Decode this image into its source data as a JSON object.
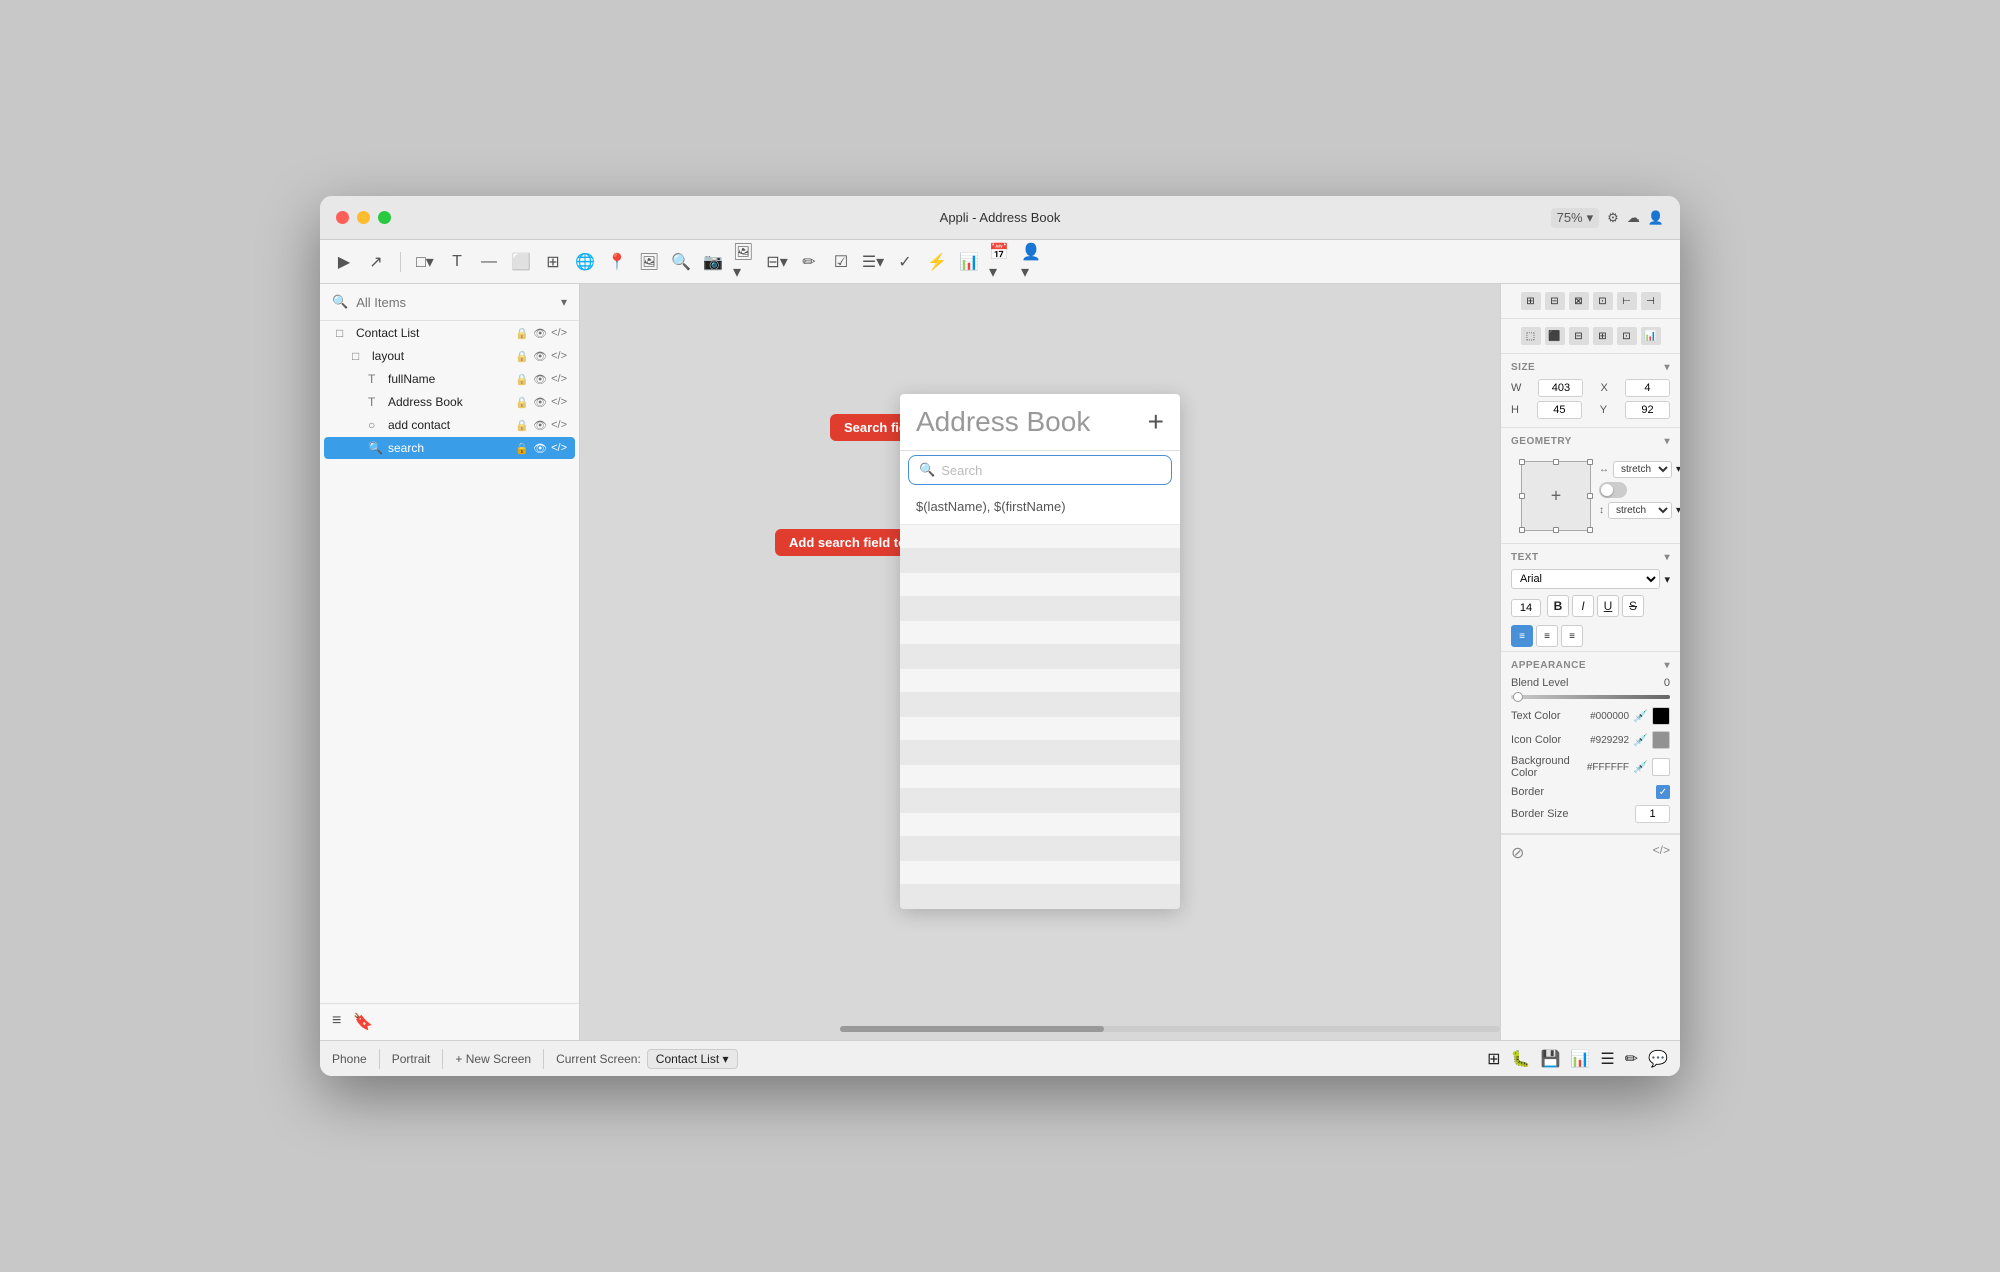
{
  "window": {
    "title": "Appli - Address Book",
    "controls": {
      "red": "●",
      "yellow": "●",
      "green": "●"
    }
  },
  "toolbar": {
    "zoom": "75%",
    "icons": [
      "▶",
      "↗",
      "□",
      "T",
      "—",
      "⬜",
      "⊞",
      "🌐",
      "📍",
      "🖼",
      "🔍",
      "📷",
      "🖼",
      "⊟",
      "✏",
      "☑",
      "☰",
      "✓",
      "⚡",
      "📊",
      "📅",
      "👤"
    ]
  },
  "sidebar": {
    "search_placeholder": "All Items",
    "items": [
      {
        "label": "Contact List",
        "icon": "□",
        "indent": 0,
        "type": "screen"
      },
      {
        "label": "layout",
        "icon": "□",
        "indent": 1,
        "type": "layout"
      },
      {
        "label": "fullName",
        "icon": "T",
        "indent": 2,
        "type": "text"
      },
      {
        "label": "Address Book",
        "icon": "T",
        "indent": 2,
        "type": "text"
      },
      {
        "label": "add contact",
        "icon": "○",
        "indent": 2,
        "type": "button"
      },
      {
        "label": "search",
        "icon": "🔍",
        "indent": 2,
        "type": "search",
        "selected": true
      }
    ],
    "footer": {
      "list_icon": "≡",
      "bookmark_icon": "🔖"
    }
  },
  "annotations": {
    "search_field": "Search field element",
    "add_search": "Add search field to screen"
  },
  "phone": {
    "title": "Address Book",
    "add_button": "+",
    "search_placeholder": "Search",
    "list_item": "$(lastName), $(firstName)",
    "stripe_count": 16
  },
  "right_panel": {
    "align_icons": [
      "⊞",
      "⊟",
      "⊠",
      "⊡",
      "⊢",
      "⊣"
    ],
    "size": {
      "label": "SIZE",
      "w_label": "W",
      "w_value": "403",
      "x_label": "X",
      "x_value": "4",
      "h_label": "H",
      "h_value": "45",
      "y_label": "Y",
      "y_value": "92"
    },
    "geometry": {
      "label": "GEOMETRY",
      "stretch_h": "stretch",
      "stretch_v": "stretch"
    },
    "text": {
      "label": "TEXT",
      "font": "Arial",
      "size": "14",
      "bold": "B",
      "italic": "I",
      "underline": "U",
      "strike": "S",
      "align_left": "≡",
      "align_center": "≡",
      "align_right": "≡"
    },
    "appearance": {
      "label": "APPEARANCE",
      "blend_level_label": "Blend Level",
      "blend_value": "0",
      "text_color_label": "Text Color",
      "text_color_hex": "#000000",
      "icon_color_label": "Icon Color",
      "icon_color_hex": "#929292",
      "bg_color_label": "Background Color",
      "bg_color_hex": "#FFFFFF",
      "border_label": "Border",
      "border_size_label": "Border Size",
      "border_size_value": "1"
    },
    "footer": {
      "no_icon": "⊘",
      "code_icon": "</>"
    }
  },
  "bottom_bar": {
    "phone_label": "Phone",
    "portrait_label": "Portrait",
    "new_screen": "+ New Screen",
    "current_screen_label": "Current Screen:",
    "current_screen_value": "Contact List",
    "icons": [
      "⊞",
      "🐛",
      "💾",
      "📊",
      "☰",
      "✏",
      "💬"
    ]
  }
}
